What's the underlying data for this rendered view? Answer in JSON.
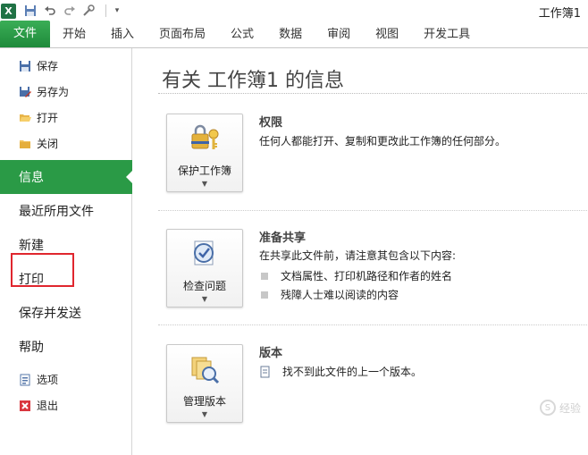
{
  "window": {
    "title": "工作簿1"
  },
  "quick_access": {
    "icons": [
      "excel-logo",
      "save-icon",
      "undo-icon",
      "redo-icon",
      "customize-icon"
    ],
    "logo_letter": "X"
  },
  "ribbon": {
    "tabs": [
      "文件",
      "开始",
      "插入",
      "页面布局",
      "公式",
      "数据",
      "审阅",
      "视图",
      "开发工具"
    ]
  },
  "nav": {
    "small_top": [
      {
        "label": "保存",
        "icon": "save-icon"
      },
      {
        "label": "另存为",
        "icon": "save-as-icon"
      },
      {
        "label": "打开",
        "icon": "open-folder-icon"
      },
      {
        "label": "关闭",
        "icon": "close-folder-icon"
      }
    ],
    "big": [
      "信息",
      "最近所用文件",
      "新建",
      "打印",
      "保存并发送",
      "帮助"
    ],
    "active": "信息",
    "small_bottom": [
      {
        "label": "选项",
        "icon": "options-icon"
      },
      {
        "label": "退出",
        "icon": "exit-icon"
      }
    ]
  },
  "main": {
    "title": "有关 工作簿1 的信息",
    "sections": [
      {
        "button_label": "保护工作簿",
        "icon": "lock-key-icon",
        "heading": "权限",
        "text": "任何人都能打开、复制和更改此工作簿的任何部分。"
      },
      {
        "button_label": "检查问题",
        "icon": "check-document-icon",
        "heading": "准备共享",
        "text": "在共享此文件前，请注意其包含以下内容:",
        "bullets": [
          "文档属性、打印机路径和作者的姓名",
          "残障人士难以阅读的内容"
        ]
      },
      {
        "button_label": "管理版本",
        "icon": "versions-icon",
        "heading": "版本",
        "text": "找不到此文件的上一个版本。"
      }
    ]
  },
  "watermark": {
    "text": "经验"
  },
  "colors": {
    "accent_green": "#2a9a46",
    "highlight_red": "#e0262e"
  }
}
